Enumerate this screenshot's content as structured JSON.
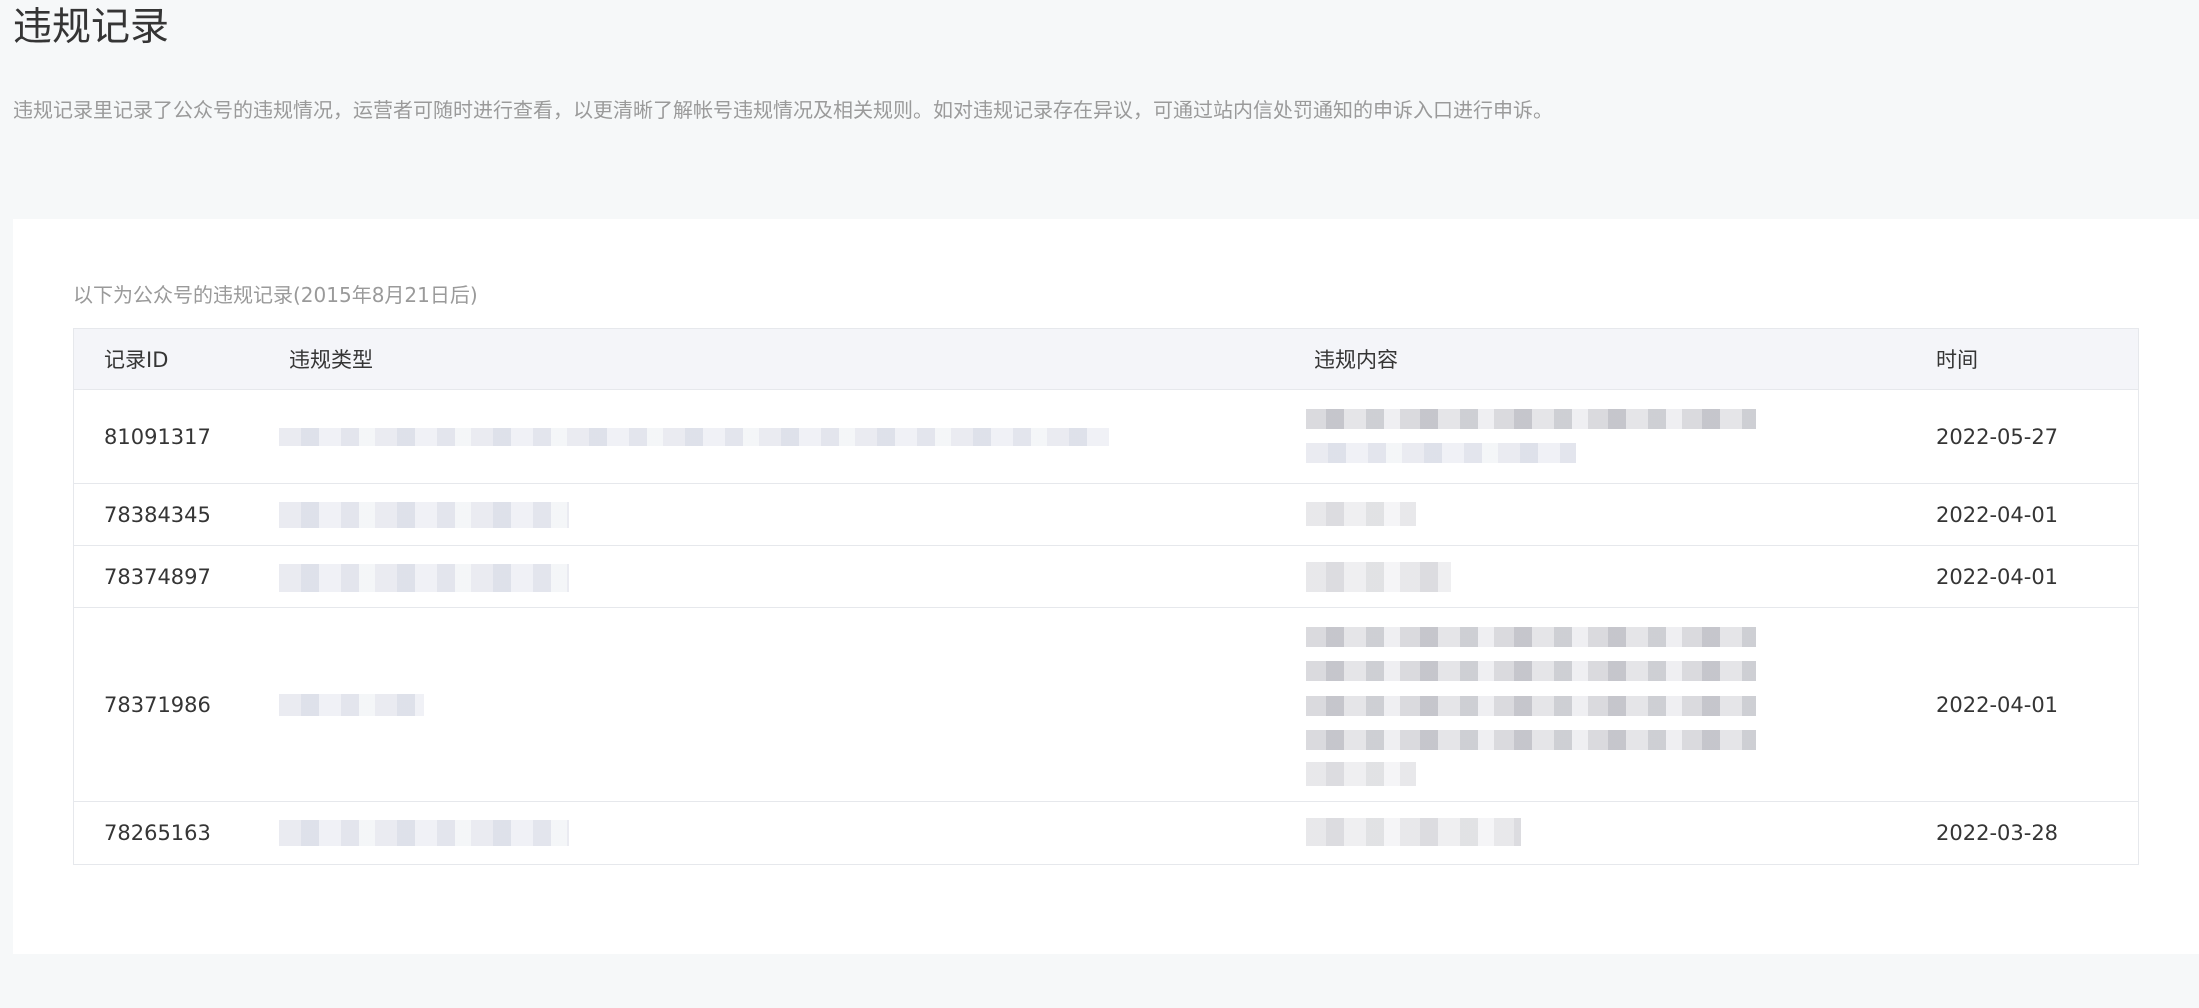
{
  "page": {
    "title": "违规记录",
    "description": "违规记录里记录了公众号的违规情况，运营者可随时进行查看，以更清晰了解帐号违规情况及相关规则。如对违规记录存在异议，可通过站内信处罚通知的申诉入口进行申诉。"
  },
  "table": {
    "caption": "以下为公众号的违规记录(2015年8月21日后)",
    "headers": {
      "id": "记录ID",
      "type": "违规类型",
      "content": "违规内容",
      "time": "时间"
    },
    "rows": [
      {
        "id": "81091317",
        "time": "2022-05-27"
      },
      {
        "id": "78384345",
        "time": "2022-04-01"
      },
      {
        "id": "78374897",
        "time": "2022-04-01"
      },
      {
        "id": "78371986",
        "time": "2022-04-01"
      },
      {
        "id": "78265163",
        "time": "2022-03-28"
      }
    ]
  }
}
